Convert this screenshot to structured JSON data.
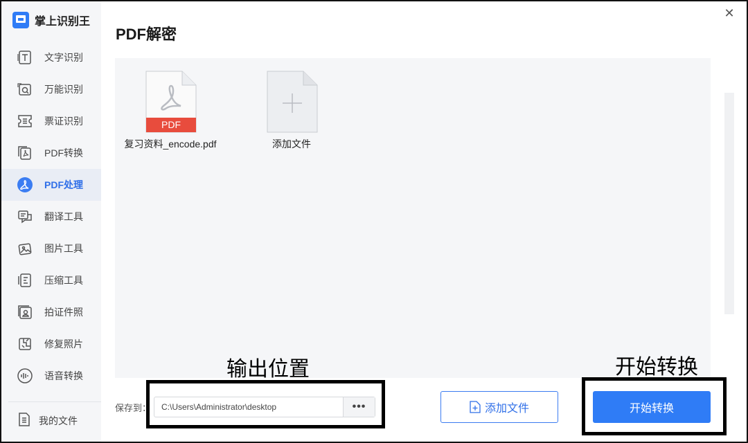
{
  "app": {
    "name": "掌上识别王",
    "brand_color": "#2f7cf6"
  },
  "sidebar": {
    "items": [
      {
        "label": "文字识别",
        "icon": "text-recognition-icon"
      },
      {
        "label": "万能识别",
        "icon": "universal-recognition-icon"
      },
      {
        "label": "票证识别",
        "icon": "ticket-recognition-icon"
      },
      {
        "label": "PDF转换",
        "icon": "pdf-convert-icon"
      },
      {
        "label": "PDF处理",
        "icon": "pdf-process-icon",
        "active": true
      },
      {
        "label": "翻译工具",
        "icon": "translate-icon"
      },
      {
        "label": "图片工具",
        "icon": "image-tool-icon"
      },
      {
        "label": "压缩工具",
        "icon": "compress-icon"
      },
      {
        "label": "拍证件照",
        "icon": "id-photo-icon"
      },
      {
        "label": "修复照片",
        "icon": "photo-repair-icon"
      },
      {
        "label": "语音转换",
        "icon": "voice-convert-icon"
      }
    ],
    "my_files": "我的文件"
  },
  "main": {
    "title": "PDF解密",
    "files": [
      {
        "name": "复习资料_encode.pdf",
        "badge": "PDF",
        "icon": "pdf-file-icon"
      }
    ],
    "add_tile_label": "添加文件",
    "save_to_label": "保存到：",
    "save_path": "C:\\Users\\Administrator\\desktop",
    "more_label": "•••",
    "add_file_button": "添加文件",
    "start_button": "开始转换"
  },
  "annotations": {
    "output_location": "输出位置",
    "start_conversion": "开始转换"
  },
  "colors": {
    "accent": "#2f7cf6",
    "pdf_red": "#e84c3d",
    "active_bg": "#e9edf5"
  }
}
